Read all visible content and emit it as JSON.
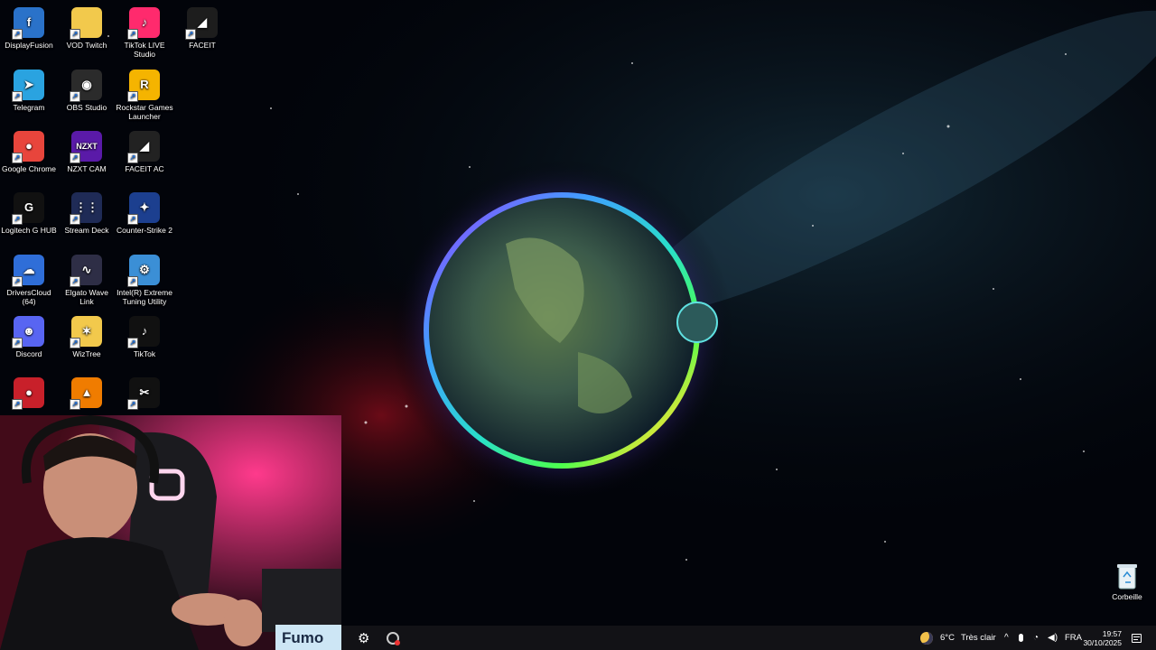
{
  "desktop_icons": [
    {
      "label": "DisplayFusion",
      "glyph": "f",
      "color": "#2a72c9"
    },
    {
      "label": "VOD Twitch",
      "glyph": "",
      "color": "#f2c94c"
    },
    {
      "label": "TikTok LIVE Studio",
      "glyph": "♪",
      "color": "#ff2a6d"
    },
    {
      "label": "FACEIT",
      "glyph": "◢",
      "color": "#1d1d1d"
    },
    {
      "label": "Telegram",
      "glyph": "➤",
      "color": "#2aa3e0"
    },
    {
      "label": "OBS Studio",
      "glyph": "◉",
      "color": "#2b2b2b"
    },
    {
      "label": "Rockstar Games Launcher",
      "glyph": "R",
      "color": "#f5b400"
    },
    {
      "label": "Google Chrome",
      "glyph": "●",
      "color": "#e8453c"
    },
    {
      "label": "NZXT CAM",
      "glyph": "NZXT",
      "color": "#5a1aa8"
    },
    {
      "label": "FACEIT AC",
      "glyph": "◢",
      "color": "#222222"
    },
    {
      "label": "Logitech G HUB",
      "glyph": "G",
      "color": "#111111"
    },
    {
      "label": "Stream Deck",
      "glyph": "⋮⋮",
      "color": "#1f2b56"
    },
    {
      "label": "Counter-Strike 2",
      "glyph": "✦",
      "color": "#1c3f8f"
    },
    {
      "label": "DriversCloud (64)",
      "glyph": "☁",
      "color": "#2f6ed8"
    },
    {
      "label": "Elgato Wave Link",
      "glyph": "∿",
      "color": "#2e2e46"
    },
    {
      "label": "Intel(R) Extreme Tuning Utility",
      "glyph": "⚙",
      "color": "#3b8fd6"
    },
    {
      "label": "Discord",
      "glyph": "☻",
      "color": "#5865f2"
    },
    {
      "label": "WizTree",
      "glyph": "✶",
      "color": "#f2c94c"
    },
    {
      "label": "TikTok",
      "glyph": "♪",
      "color": "#111111"
    },
    {
      "label": "",
      "glyph": "●",
      "color": "#c8202a"
    },
    {
      "label": "",
      "glyph": "▲",
      "color": "#f07c00"
    },
    {
      "label": "",
      "glyph": "✂",
      "color": "#111111"
    }
  ],
  "recycle_bin": {
    "label": "Corbeille"
  },
  "webcam": {
    "sign_text": "Fumo"
  },
  "taskbar": {
    "weather_temp": "6°C",
    "weather_desc": "Très clair",
    "language": "FRA",
    "time": "19:57",
    "date": "30/10/2025"
  }
}
